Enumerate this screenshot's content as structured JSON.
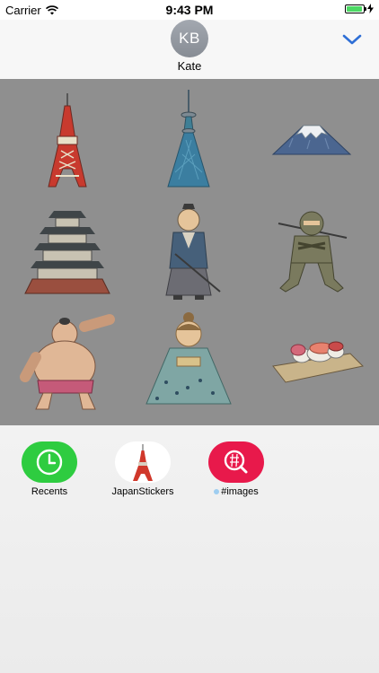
{
  "status_bar": {
    "carrier": "Carrier",
    "time": "9:43 PM",
    "battery_level": 0.95
  },
  "header": {
    "avatar_initials": "KB",
    "contact_name": "Kate"
  },
  "stickers": [
    {
      "icon": "tokyo-tower-sticker"
    },
    {
      "icon": "skytree-sticker"
    },
    {
      "icon": "mount-fuji-sticker"
    },
    {
      "icon": "castle-sticker"
    },
    {
      "icon": "samurai-sticker"
    },
    {
      "icon": "ninja-sticker"
    },
    {
      "icon": "sumo-wrestler-sticker"
    },
    {
      "icon": "kimono-woman-sticker"
    },
    {
      "icon": "sushi-sticker"
    }
  ],
  "apps": [
    {
      "label": "Recents",
      "icon": "recents-clock-icon",
      "color": "#2ecc40"
    },
    {
      "label": "JapanStickers",
      "icon": "japan-stickers-icon",
      "color": "#ffffff"
    },
    {
      "label": "#images",
      "icon": "images-search-icon",
      "color": "#e8194b"
    }
  ],
  "colors": {
    "sticker_background": "#8f8f8f",
    "accent": "#2f6fd6"
  }
}
